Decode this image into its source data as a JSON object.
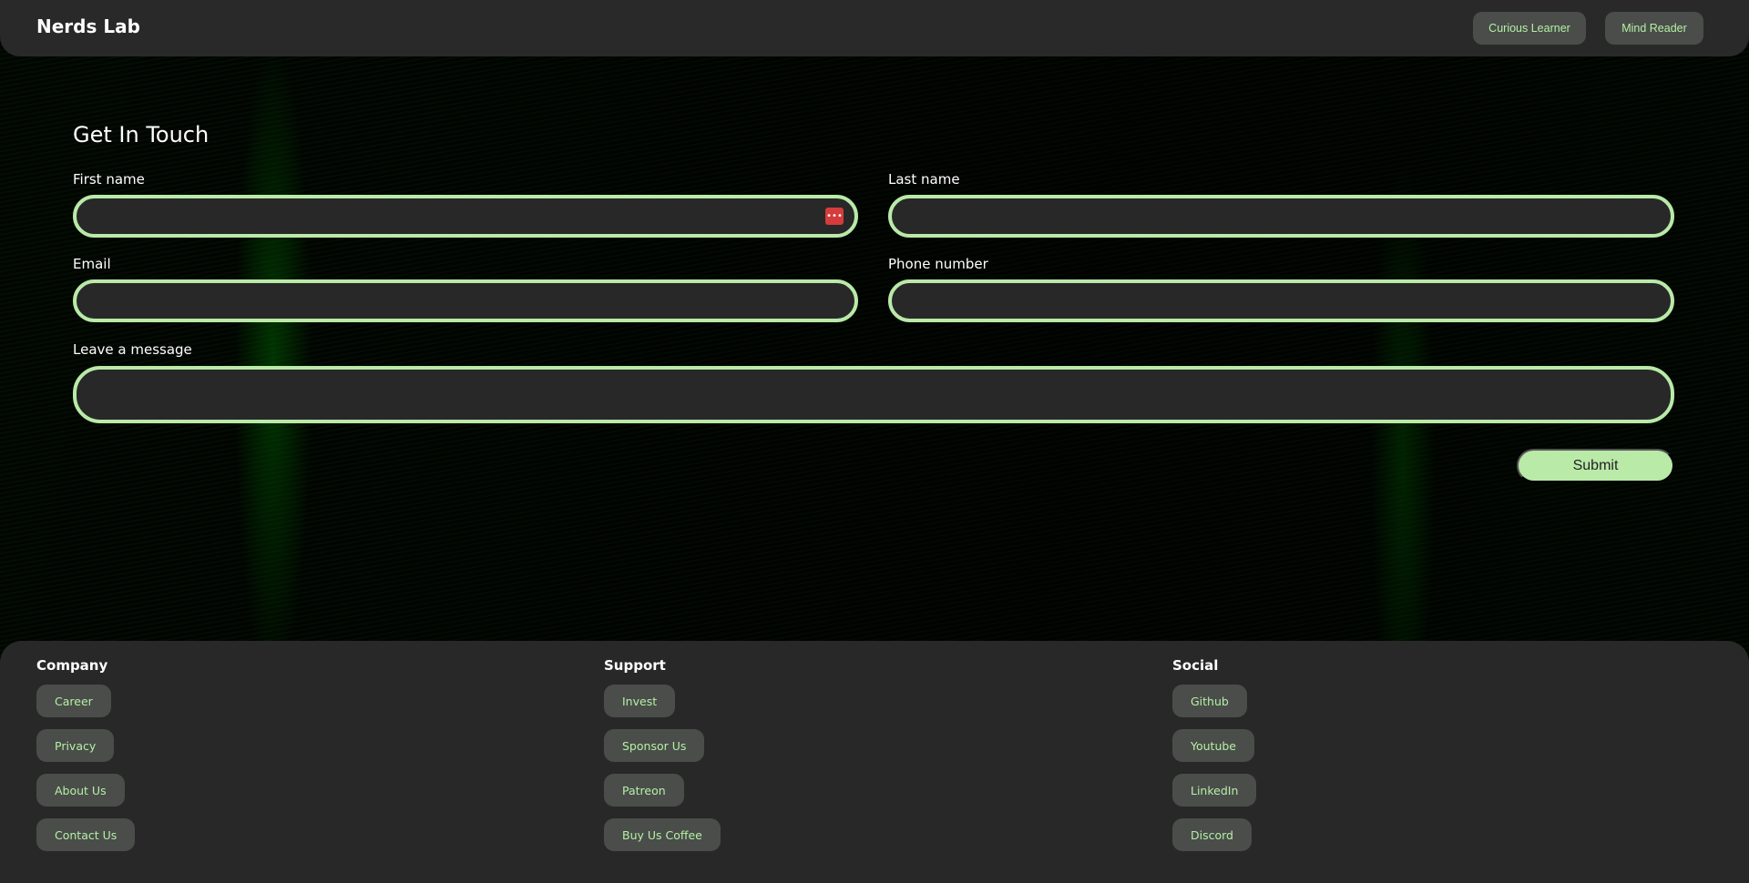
{
  "header": {
    "brand": "Nerds Lab",
    "nav": [
      "Curious Learner",
      "Mind Reader"
    ]
  },
  "form": {
    "title": "Get In Touch",
    "first_name": "First name",
    "last_name": "Last name",
    "email": "Email",
    "phone": "Phone number",
    "message": "Leave a message",
    "submit": "Submit"
  },
  "footer": {
    "columns": [
      {
        "title": "Company",
        "links": [
          "Career",
          "Privacy",
          "About Us",
          "Contact Us"
        ]
      },
      {
        "title": "Support",
        "links": [
          "Invest",
          "Sponsor Us",
          "Patreon",
          "Buy Us Coffee"
        ]
      },
      {
        "title": "Social",
        "links": [
          "Github",
          "Youtube",
          "LinkedIn",
          "Discord"
        ]
      }
    ]
  },
  "colors": {
    "accent": "#b9eaa8",
    "panel": "#282828",
    "pill": "#4a4d4a"
  }
}
